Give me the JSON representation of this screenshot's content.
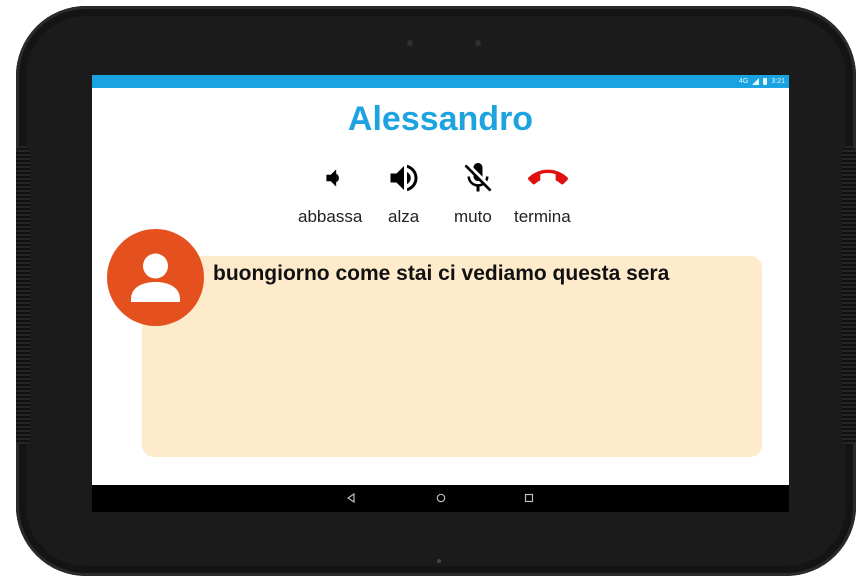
{
  "status_bar": {
    "network": "4G",
    "time": "3:21"
  },
  "caller": {
    "name": "Alessandro"
  },
  "controls": [
    {
      "icon": "volume-down-icon",
      "label": "abbassa"
    },
    {
      "icon": "volume-up-icon",
      "label": "alza"
    },
    {
      "icon": "mic-off-icon",
      "label": "muto"
    },
    {
      "icon": "call-end-icon",
      "label": "termina",
      "color": "#e01010"
    }
  ],
  "message": {
    "text": "buongiorno come stai ci vediamo questa sera",
    "avatar_icon": "person-icon",
    "avatar_color": "#e4511f",
    "bubble_color": "#fdebcc"
  },
  "nav": {
    "back_icon": "back-icon",
    "home_icon": "home-icon",
    "recents_icon": "recents-icon"
  },
  "colors": {
    "accent": "#1ea3e0",
    "status_bar": "#1aa3e1"
  }
}
